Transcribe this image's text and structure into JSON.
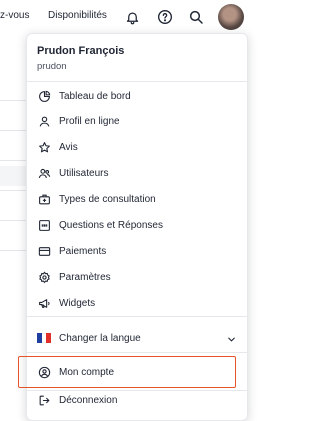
{
  "topbar": {
    "nav_partial": "z-vous",
    "availability": "Disponibilités",
    "icons": [
      "bell-icon",
      "help-icon",
      "search-icon"
    ]
  },
  "user": {
    "name": "Prudon François",
    "login": "prudon"
  },
  "menu": {
    "items": [
      {
        "label": "Tableau de bord",
        "icon": "pie-chart-icon"
      },
      {
        "label": "Profil en ligne",
        "icon": "user-icon"
      },
      {
        "label": "Avis",
        "icon": "star-icon"
      },
      {
        "label": "Utilisateurs",
        "icon": "users-icon"
      },
      {
        "label": "Types de consultation",
        "icon": "medical-case-icon"
      },
      {
        "label": "Questions et Réponses",
        "icon": "quote-icon"
      },
      {
        "label": "Paiements",
        "icon": "credit-card-icon"
      },
      {
        "label": "Paramètres",
        "icon": "gear-icon"
      },
      {
        "label": "Widgets",
        "icon": "megaphone-icon"
      }
    ],
    "language": {
      "label": "Changer la langue",
      "flag_colors": [
        "#1f3fa0",
        "#ffffff",
        "#e1302a"
      ]
    },
    "account": {
      "label": "Mon compte",
      "icon": "user-circle-icon"
    },
    "logout": {
      "label": "Déconnexion",
      "icon": "logout-icon"
    }
  },
  "colors": {
    "highlight": "#e8542a",
    "text": "#1f2533"
  }
}
